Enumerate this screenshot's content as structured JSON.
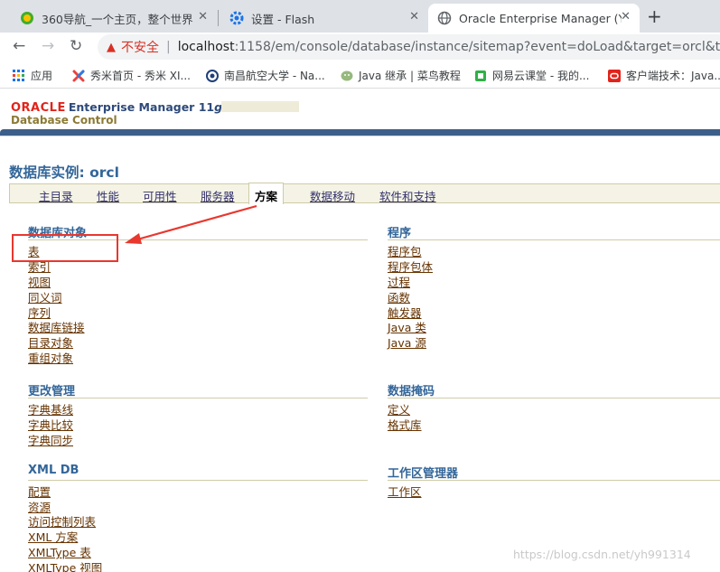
{
  "browser": {
    "tabs": [
      {
        "title": "360导航_一个主页，整个世界",
        "icon": "360-icon"
      },
      {
        "title": "设置 - Flash",
        "icon": "gear-icon"
      },
      {
        "title": "Oracle Enterprise Manager (Y",
        "icon": "globe-icon"
      }
    ],
    "close_glyph": "✕",
    "new_tab_glyph": "+",
    "address": {
      "warning": "不安全",
      "host": "localhost",
      "path": ":1158/em/console/database/instance/sitemap?event=doLoad&target=orcl&type=o"
    },
    "bookmarks": [
      {
        "label": "应用",
        "icon": "apps-grid-icon"
      },
      {
        "label": "秀米首页 - 秀米 XI...",
        "icon": "xiumi-icon"
      },
      {
        "label": "南昌航空大学 - Na...",
        "icon": "university-icon"
      },
      {
        "label": "Java 继承 | 菜鸟教程",
        "icon": "runoob-icon"
      },
      {
        "label": "网易云课堂 - 我的...",
        "icon": "netease-icon"
      },
      {
        "label": "客户端技术：Java...",
        "icon": "oracle-bookmark-icon"
      }
    ]
  },
  "brand": {
    "oracle": "ORACLE",
    "em": "Enterprise Manager 11",
    "em_version_letter": "g",
    "subtitle": "Database Control"
  },
  "page_title": "数据库实例: orcl",
  "subtabs": [
    "主目录",
    "性能",
    "可用性",
    "服务器",
    "方案",
    "数据移动",
    "软件和支持"
  ],
  "active_subtab": "方案",
  "sections": {
    "db_objects": {
      "heading": "数据库对象",
      "links": [
        "表",
        "索引",
        "视图",
        "同义词",
        "序列",
        "数据库链接",
        "目录对象",
        "重组对象"
      ]
    },
    "programs": {
      "heading": "程序",
      "links": [
        "程序包",
        "程序包体",
        "过程",
        "函数",
        "触发器",
        "Java 类",
        "Java 源"
      ]
    },
    "change_mgmt": {
      "heading": "更改管理",
      "links": [
        "字典基线",
        "字典比较",
        "字典同步"
      ]
    },
    "data_masking": {
      "heading": "数据掩码",
      "links": [
        "定义",
        "格式库"
      ]
    },
    "xml_db": {
      "heading": "XML DB",
      "links": [
        "配置",
        "资源",
        "访问控制列表",
        "XML 方案",
        "XMLType 表",
        "XMLType 视图"
      ]
    },
    "workspace": {
      "heading": "工作区管理器",
      "links": [
        "工作区"
      ]
    }
  },
  "watermark": "https://blog.csdn.net/yh991314",
  "colors": {
    "heading_blue": "#336699",
    "link_brown": "#663300",
    "annotation_red": "#e8382f",
    "oracle_red": "#e2231a"
  }
}
